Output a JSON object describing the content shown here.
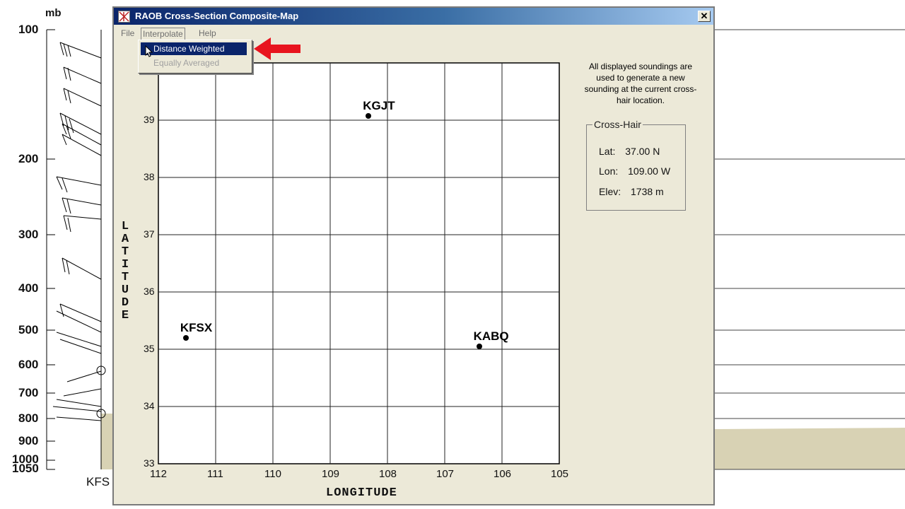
{
  "background": {
    "unit": "mb",
    "pressure_levels": [
      "100",
      "200",
      "300",
      "400",
      "500",
      "600",
      "700",
      "800",
      "900",
      "1000",
      "1050"
    ],
    "station_label": "KFS"
  },
  "dialog": {
    "title": "RAOB Cross-Section Composite-Map",
    "close_glyph": "✕",
    "menu": {
      "file": "File",
      "interpolate": "Interpolate",
      "help": "Help"
    },
    "dropdown": {
      "items": [
        "Distance Weighted",
        "Equally Averaged"
      ],
      "highlighted": "Distance Weighted"
    },
    "annotation_arrow_color": "#e8141e",
    "info_text": "All displayed soundings are used to generate a new sounding at the current cross-hair location.",
    "crosshair": {
      "title": "Cross-Hair",
      "lat_label": "Lat:",
      "lat_value": "37.00",
      "lat_unit": "N",
      "lon_label": "Lon:",
      "lon_value": "109.00",
      "lon_unit": "W",
      "elev_label": "Elev:",
      "elev_value": "1738 m"
    },
    "map": {
      "y_axis_title": "LATITUDE",
      "x_axis_title": "LONGITUDE",
      "lat_ticks": [
        "39",
        "38",
        "37",
        "36",
        "35",
        "34",
        "33"
      ],
      "lon_ticks": [
        "112",
        "111",
        "110",
        "109",
        "108",
        "107",
        "106",
        "105"
      ],
      "stations": [
        {
          "name": "KGJT",
          "lat": 39.07,
          "lon": 108.33
        },
        {
          "name": "KFSX",
          "lat": 35.2,
          "lon": 111.52
        },
        {
          "name": "KABQ",
          "lat": 35.05,
          "lon": 106.4
        }
      ]
    }
  }
}
